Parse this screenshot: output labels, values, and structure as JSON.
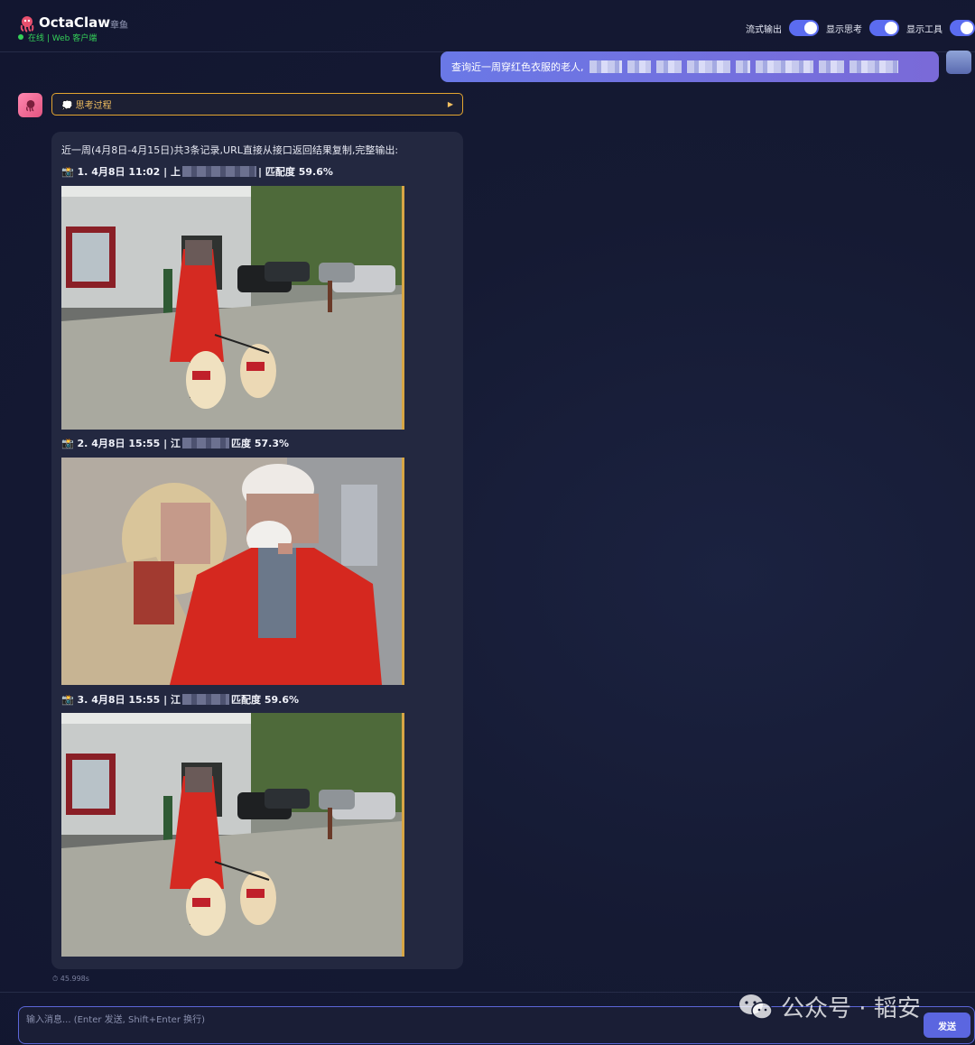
{
  "header": {
    "title": "OctaClaw",
    "subtitle": "章鱼",
    "status": "在线 | Web 客户端",
    "toggles": [
      {
        "label": "流式输出",
        "on": true
      },
      {
        "label": "显示思考",
        "on": true
      },
      {
        "label": "显示工具",
        "on": true
      }
    ]
  },
  "user_message": {
    "text": "查询近一周穿红色衣服的老人,"
  },
  "assistant": {
    "thinking_label": "💭 思考过程",
    "thinking_toggle_icon": "▶",
    "intro": "近一周(4月8日-4月15日)共3条记录,URL直接从接口返回结果复制,完整输出:",
    "results": [
      {
        "prefix": "📸 1. 4月8日 11:02 | 上",
        "suffix": "| 匹配度 59.6%"
      },
      {
        "prefix": "📸 2. 4月8日 15:55 | 江",
        "suffix": "匹度 57.3%"
      },
      {
        "prefix": "📸 3. 4月8日 15:55 | 江",
        "suffix": "匹配度 59.6%"
      }
    ],
    "elapsed": "⏱ 45.998s"
  },
  "input": {
    "placeholder": "输入消息... (Enter 发送, Shift+Enter 换行)",
    "send_label": "发送"
  },
  "watermark": "公众号 · 韬安",
  "colors": {
    "accent": "#5b66e0",
    "thinking_border": "#e3a530",
    "online": "#34d058"
  }
}
